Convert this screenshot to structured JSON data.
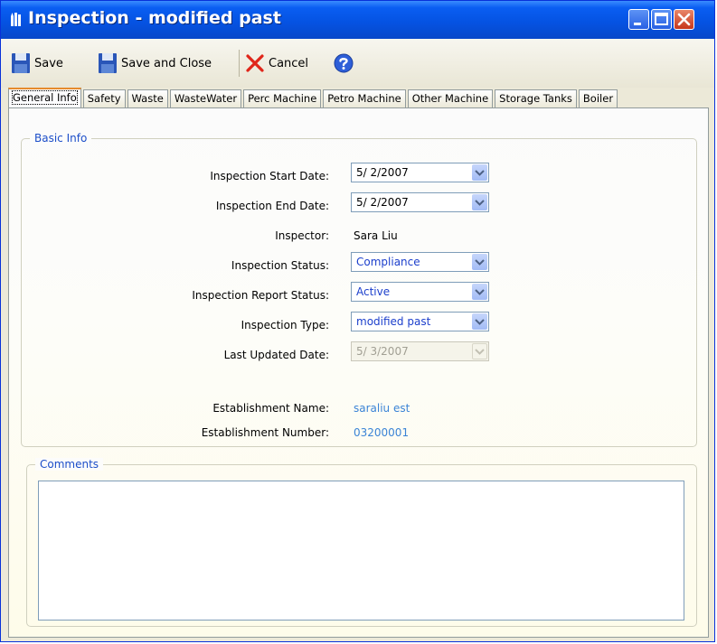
{
  "window": {
    "title": "Inspection - modified past"
  },
  "toolbar": {
    "save_label": "Save",
    "save_close_label": "Save and Close",
    "cancel_label": "Cancel"
  },
  "tabs": [
    {
      "label": "General Info",
      "active": true
    },
    {
      "label": "Safety",
      "active": false
    },
    {
      "label": "Waste",
      "active": false
    },
    {
      "label": "WasteWater",
      "active": false
    },
    {
      "label": "Perc Machine",
      "active": false
    },
    {
      "label": "Petro Machine",
      "active": false
    },
    {
      "label": "Other Machine",
      "active": false
    },
    {
      "label": "Storage Tanks",
      "active": false
    },
    {
      "label": "Boiler",
      "active": false
    }
  ],
  "basic_info": {
    "legend": "Basic Info",
    "start_date_label": "Inspection Start Date:",
    "start_date_value": "5/  2/2007",
    "end_date_label": "Inspection End Date:",
    "end_date_value": "5/  2/2007",
    "inspector_label": "Inspector:",
    "inspector_value": "Sara Liu",
    "status_label": "Inspection Status:",
    "status_value": "Compliance",
    "report_status_label": "Inspection Report Status:",
    "report_status_value": "Active",
    "type_label": "Inspection Type:",
    "type_value": "modified past",
    "last_updated_label": "Last Updated Date:",
    "last_updated_value": "5/  3/2007",
    "est_name_label": "Establishment Name:",
    "est_name_value": "saraliu est",
    "est_number_label": "Establishment Number:",
    "est_number_value": "03200001"
  },
  "comments": {
    "legend": "Comments",
    "value": ""
  },
  "colors": {
    "title_bar": "#0553e3",
    "legend_text": "#1c4ec9",
    "link_text": "#3b84d6",
    "combo_value": "#1c3fcc",
    "active_tab_accent": "#e68b2c"
  }
}
